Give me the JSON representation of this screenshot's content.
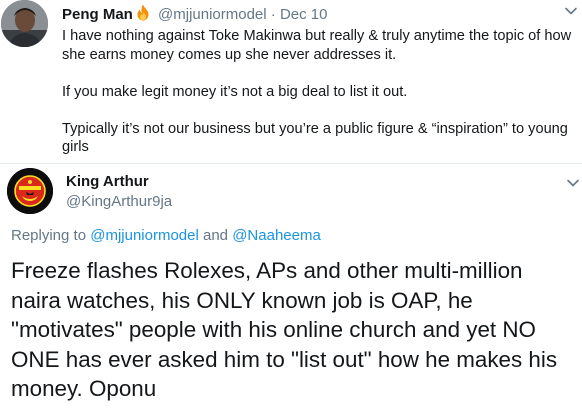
{
  "parent_tweet": {
    "author_name": "Peng Man",
    "author_icon": "fire-emoji-icon",
    "handle": "@mjjuniormodel",
    "separator": "·",
    "date": "Dec 10",
    "paragraphs": [
      "I have nothing against Toke Makinwa but really & truly anytime the topic of how she earns money comes up she never addresses it.",
      "If you make legit money it’s not a big deal to list it out.",
      "Typically it’s not our business but you’re a public figure & “inspiration” to young girls"
    ]
  },
  "main_tweet": {
    "author_name": "King Arthur",
    "handle": "@KingArthur9ja",
    "replying_prefix": "Replying to",
    "replying_mention_1": "@mjjuniormodel",
    "replying_joiner": "and",
    "replying_mention_2": "@Naaheema",
    "text": "Freeze flashes Rolexes, APs and other multi-million naira watches, his ONLY known job is OAP, he \"motivates\" people with his online church and yet NO ONE has ever asked him to \"list out\" how he makes his money. Oponu"
  },
  "colors": {
    "primary_text": "#14171a",
    "secondary_text": "#657786",
    "link": "#1b95e0",
    "divider": "#e6ecf0"
  }
}
